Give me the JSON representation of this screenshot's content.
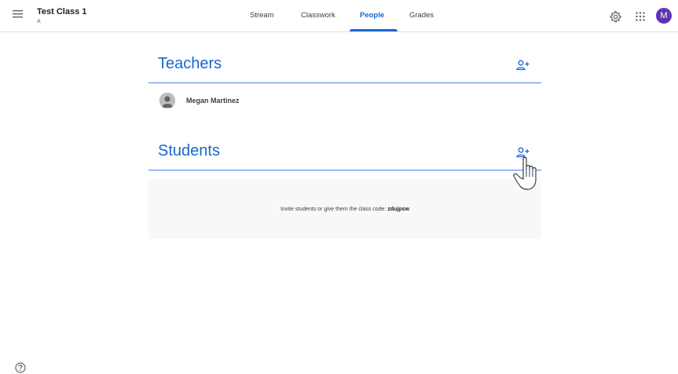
{
  "header": {
    "class_title": "Test Class 1",
    "class_section": "A",
    "tabs": [
      {
        "label": "Stream",
        "active": false
      },
      {
        "label": "Classwork",
        "active": false
      },
      {
        "label": "People",
        "active": true
      },
      {
        "label": "Grades",
        "active": false
      }
    ],
    "avatar_initial": "M",
    "icons": {
      "menu": "menu-icon",
      "settings": "settings-icon",
      "apps": "apps-grid-icon",
      "avatar": "account-avatar"
    },
    "accent_color": "#1967d2",
    "avatar_color": "#5e35b1"
  },
  "teachers": {
    "title": "Teachers",
    "add_icon": "add-person-icon",
    "members": [
      {
        "name": "Megan Martinez"
      }
    ]
  },
  "students": {
    "title": "Students",
    "add_icon": "add-person-icon",
    "invite_prefix": "Invite students or give them the class code: ",
    "class_code": "zdujpsw"
  },
  "footer": {
    "help_icon": "help-icon"
  },
  "colors": {
    "section_title": "#1967d2",
    "divider": "#4285f4",
    "panel_bg": "#f8f8f8"
  }
}
